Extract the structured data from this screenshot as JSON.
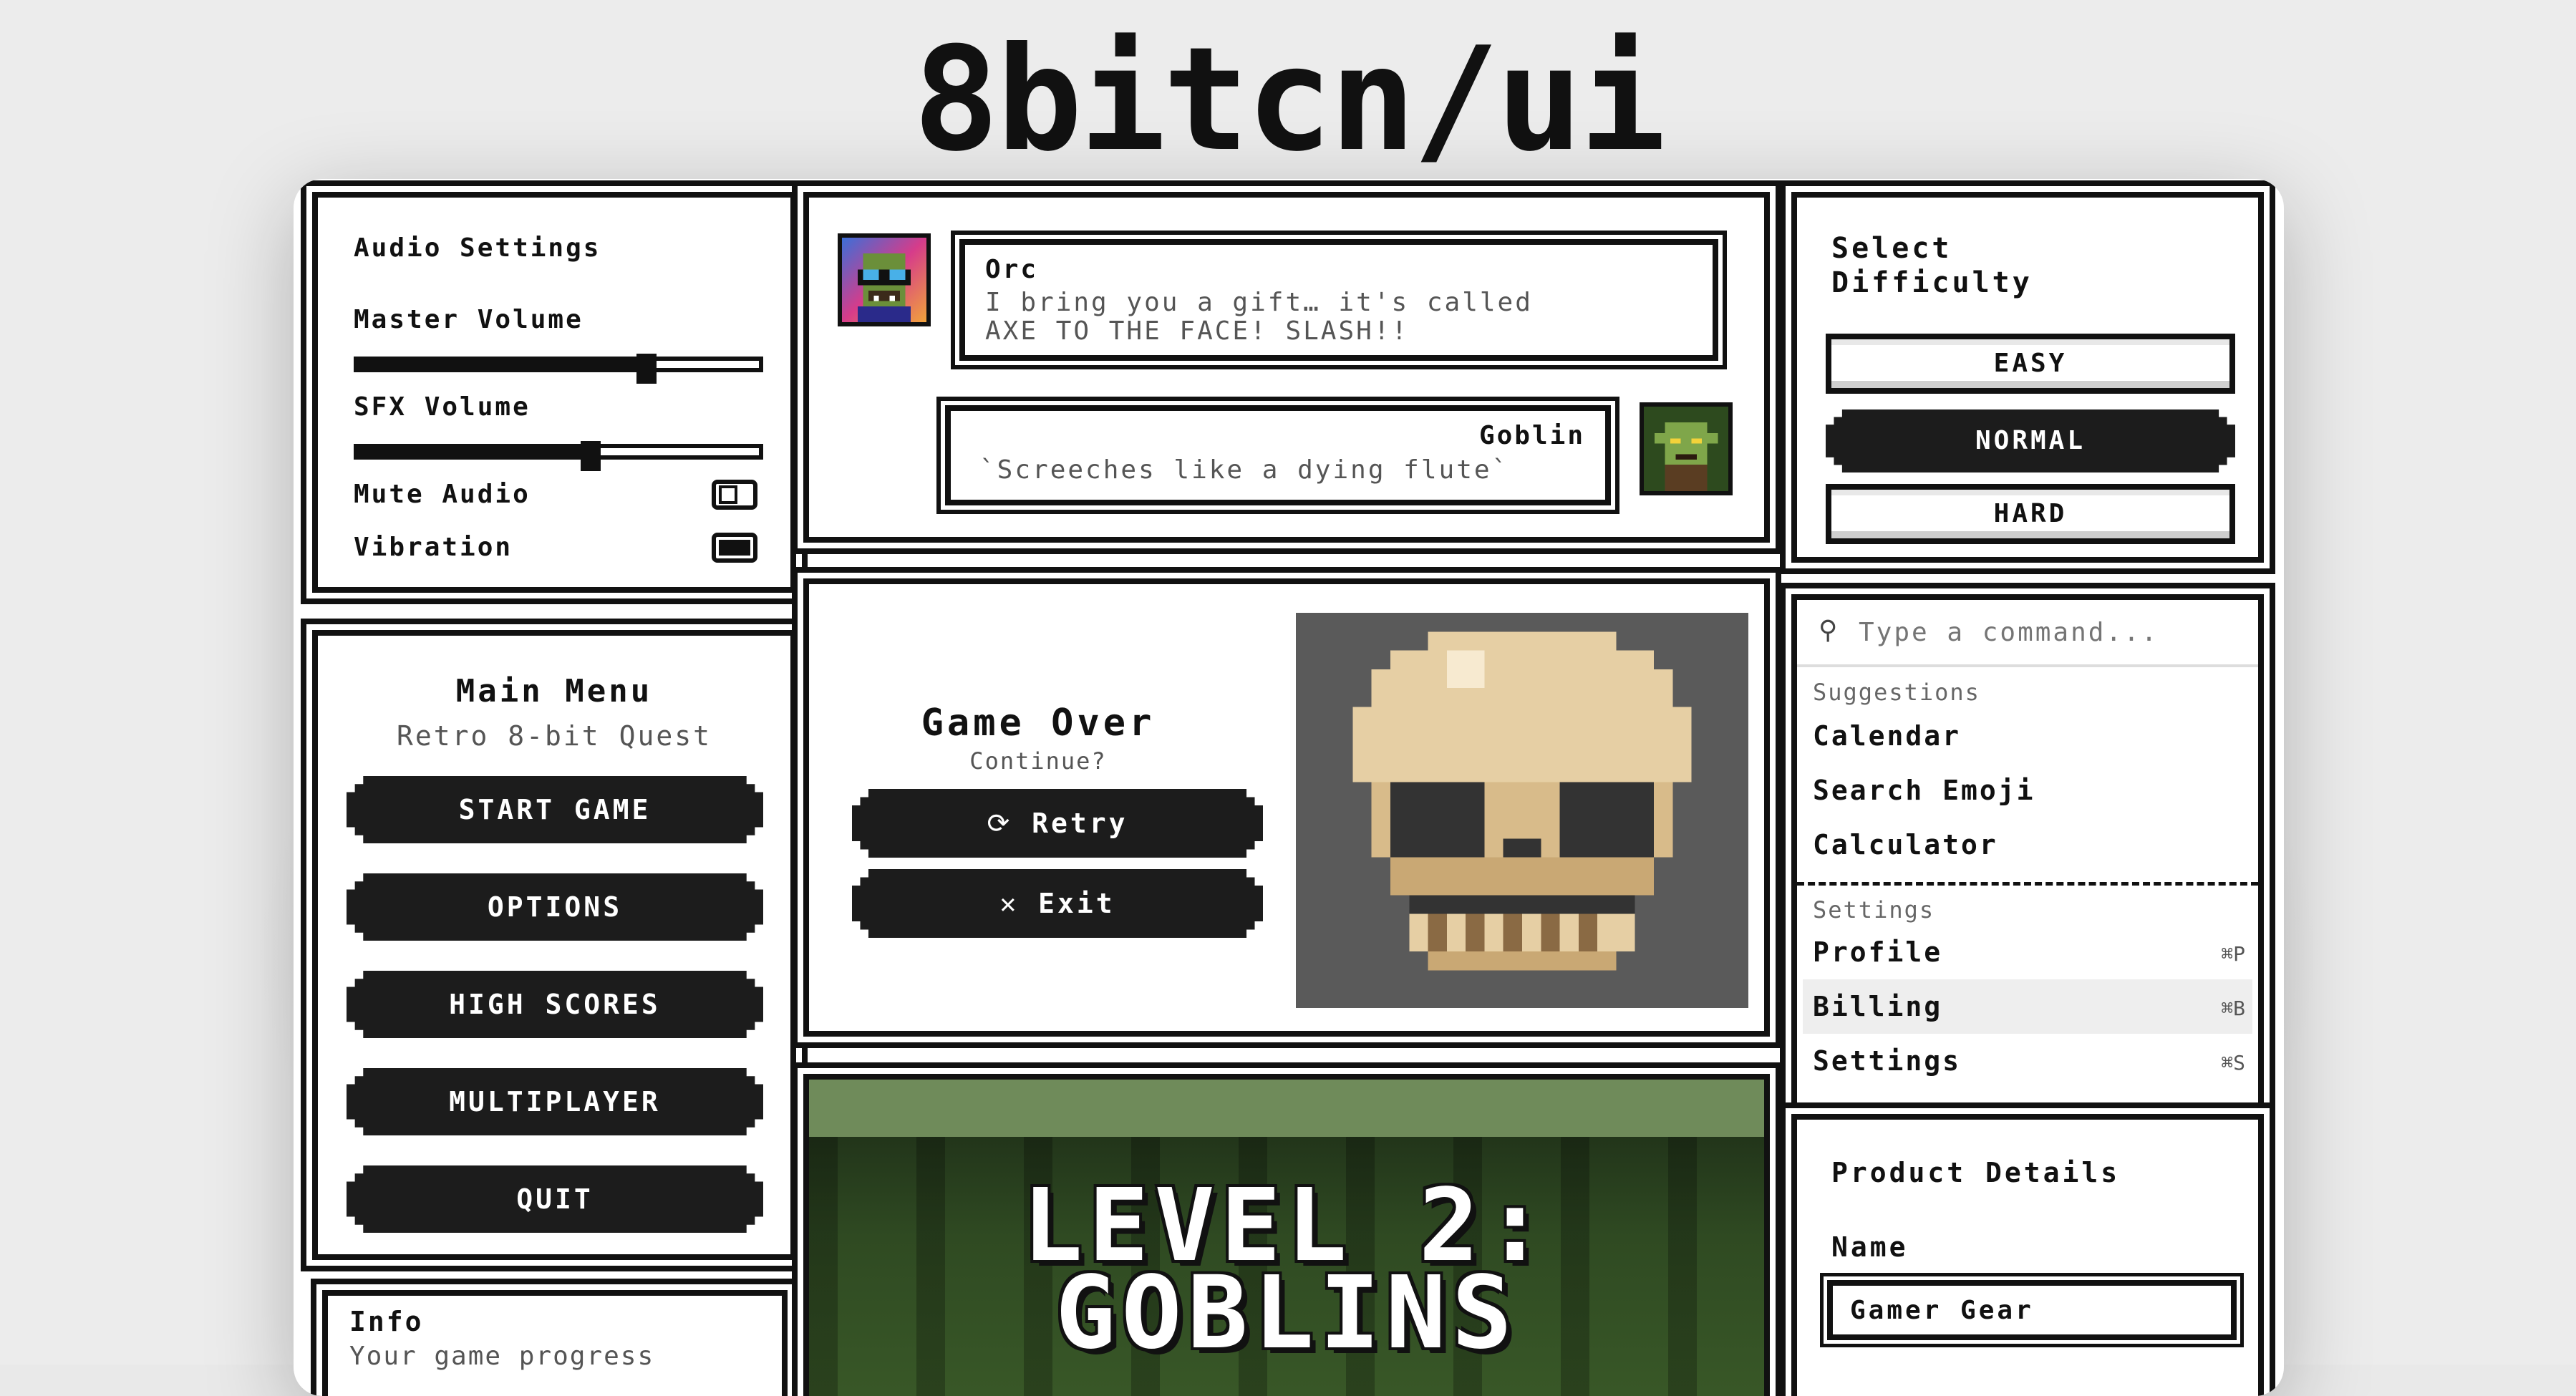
{
  "page_title": "8bitcn/ui",
  "audio": {
    "title": "Audio Settings",
    "master_volume_label": "Master Volume",
    "master_volume_value": 0.72,
    "sfx_volume_label": "SFX Volume",
    "sfx_volume_value": 0.58,
    "mute_label": "Mute Audio",
    "mute_on": false,
    "vibration_label": "Vibration",
    "vibration_on": true
  },
  "main_menu": {
    "title": "Main Menu",
    "subtitle": "Retro 8-bit Quest",
    "buttons": [
      "START GAME",
      "OPTIONS",
      "HIGH SCORES",
      "MULTIPLAYER",
      "QUIT"
    ]
  },
  "info": {
    "title": "Info",
    "text": "Your game progress"
  },
  "chat": {
    "messages": [
      {
        "speaker": "Orc",
        "text_line1": "I bring you a gift… it's called",
        "text_line2": "AXE TO THE FACE! SLASH!!",
        "avatar": "orc-avatar"
      },
      {
        "speaker": "Goblin",
        "text_line1": "`Screeches like a dying flute`",
        "avatar": "goblin-avatar"
      }
    ]
  },
  "game_over": {
    "title": "Game Over",
    "subtitle": "Continue?",
    "retry_label": "Retry",
    "exit_label": "Exit",
    "retry_icon": "refresh-icon",
    "exit_icon": "close-icon",
    "image": "pixel-skull"
  },
  "level": {
    "line1": "LEVEL 2:",
    "line2": "GOBLINS"
  },
  "difficulty": {
    "title_line1": "Select",
    "title_line2": "Difficulty",
    "options": [
      "EASY",
      "NORMAL",
      "HARD"
    ],
    "selected": "NORMAL"
  },
  "command": {
    "placeholder": "Type a command...",
    "group1": "Suggestions",
    "suggestions": [
      "Calendar",
      "Search Emoji",
      "Calculator"
    ],
    "group2": "Settings",
    "settings": [
      {
        "label": "Profile",
        "shortcut": "⌘P"
      },
      {
        "label": "Billing",
        "shortcut": "⌘B"
      },
      {
        "label": "Settings",
        "shortcut": "⌘S"
      }
    ],
    "highlighted": "Billing"
  },
  "product": {
    "title": "Product Details",
    "name_label": "Name",
    "name_value": "Gamer Gear"
  },
  "colors": {
    "ink": "#111111",
    "button_dark": "#1c1c1c",
    "skull_bg": "#5a5a5a",
    "forest": "#2f4a22"
  }
}
